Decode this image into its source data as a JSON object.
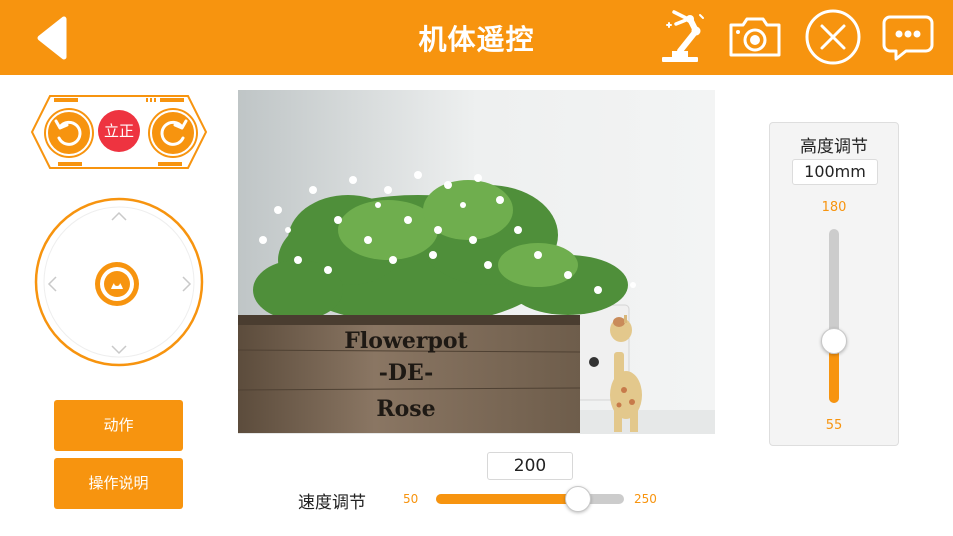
{
  "header": {
    "title": "机体遥控",
    "icons": [
      "back-arrow-icon",
      "robot-arm-icon",
      "camera-icon",
      "close-circle-icon",
      "chat-bubble-icon"
    ]
  },
  "rotation": {
    "upright_label": "立正",
    "icons": [
      "rotate-left-icon",
      "rotate-right-icon"
    ]
  },
  "joystick": {
    "icons": [
      "up-chevron-icon",
      "down-chevron-icon",
      "left-chevron-icon",
      "right-chevron-icon",
      "joystick-knob-icon"
    ]
  },
  "actions": {
    "action_label": "动作",
    "manual_label": "操作说明"
  },
  "camera_feed": {
    "sign_line1": "Flowerpot",
    "sign_line2": "-DE-",
    "sign_line3": "Rose"
  },
  "speed": {
    "label": "速度调节",
    "value": "200",
    "min": "50",
    "max": "250",
    "current": 200
  },
  "height": {
    "label": "高度调节",
    "value": "100mm",
    "max": "180",
    "min": "55",
    "current": 100
  },
  "colors": {
    "accent": "#f7940f",
    "upright": "#ee3340",
    "track": "#cccccc"
  }
}
